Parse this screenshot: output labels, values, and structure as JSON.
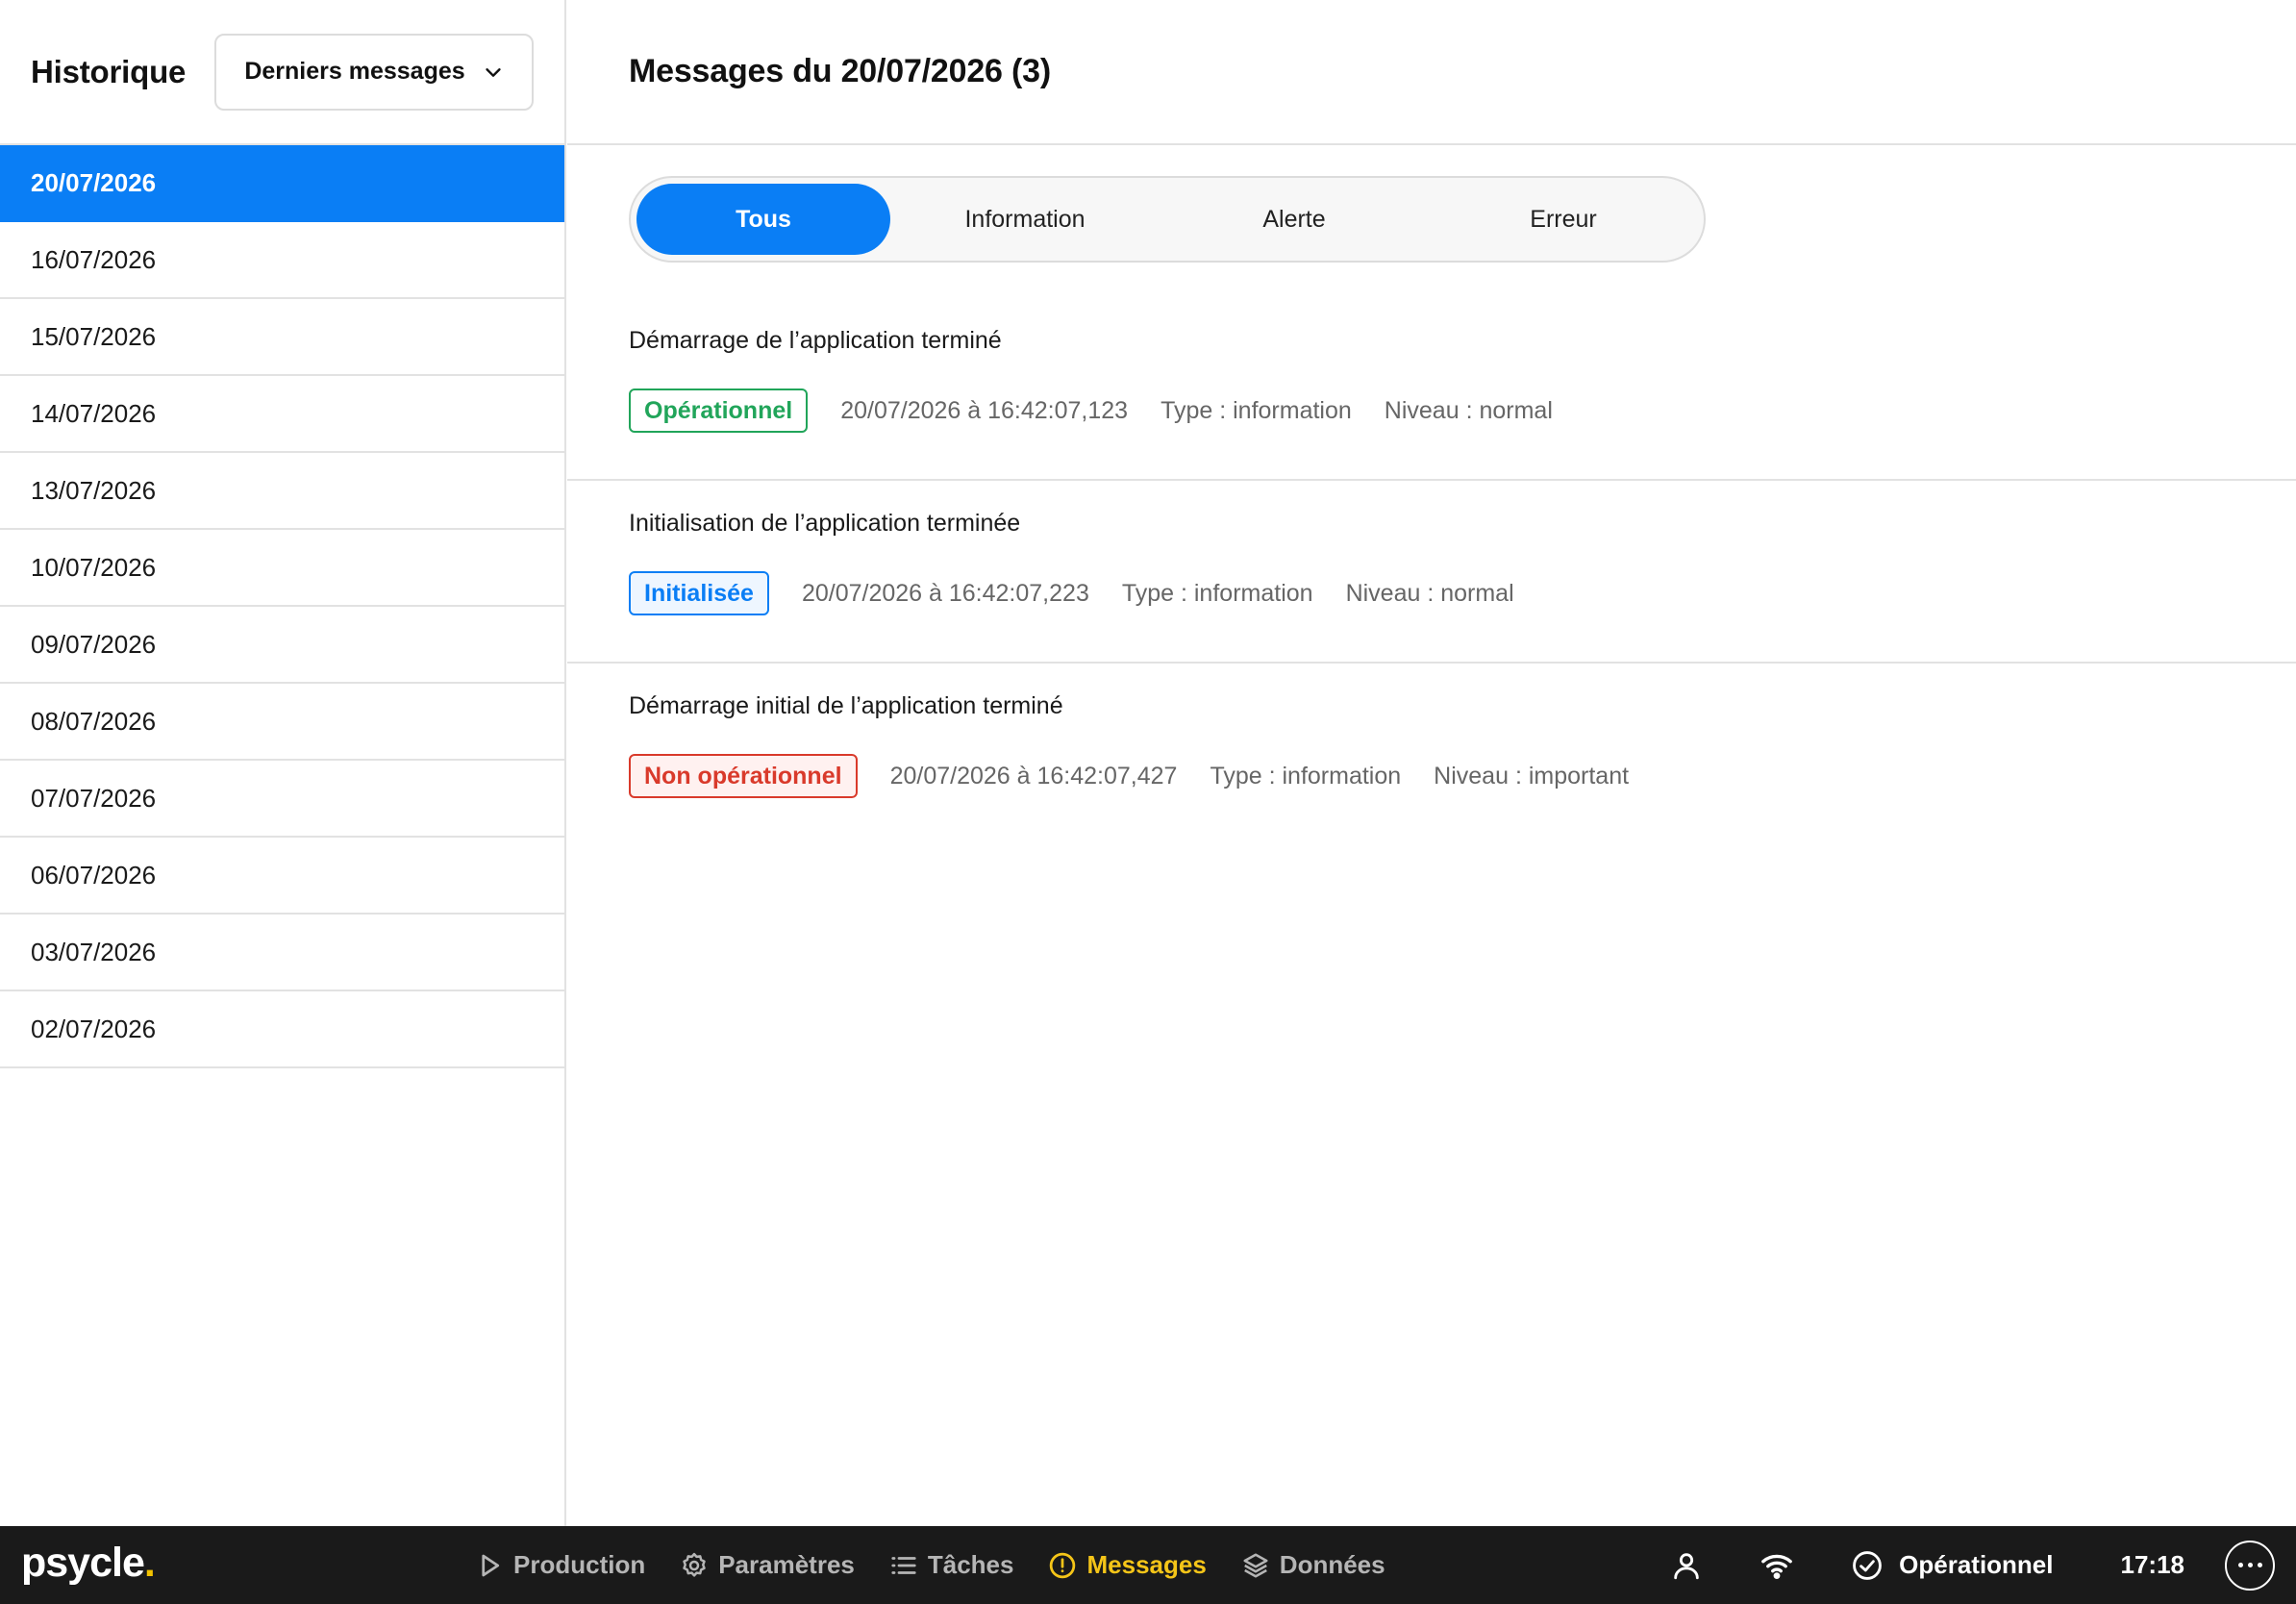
{
  "sidebar": {
    "title": "Historique",
    "dropdown": {
      "label": "Derniers messages",
      "icon": "chevron-down-icon"
    },
    "dates": [
      "20/07/2026",
      "16/07/2026",
      "15/07/2026",
      "14/07/2026",
      "13/07/2026",
      "10/07/2026",
      "09/07/2026",
      "08/07/2026",
      "07/07/2026",
      "06/07/2026",
      "03/07/2026",
      "02/07/2026"
    ],
    "selected_index": 0
  },
  "main": {
    "title": "Messages du 20/07/2026 (3)",
    "filters": [
      "Tous",
      "Information",
      "Alerte",
      "Erreur"
    ],
    "active_filter": "Tous",
    "messages": [
      {
        "title": "Démarrage de l’application terminé",
        "badge": "Opérationnel",
        "badge_color": "#21a55a",
        "timestamp": "20/07/2026 à 16:42:07,123",
        "type": "Type : information",
        "level": "Niveau : normal"
      },
      {
        "title": "Initialisation de l’application terminée",
        "badge": "Initialisée",
        "badge_color": "#0a7ef5",
        "timestamp": "20/07/2026 à 16:42:07,223",
        "type": "Type : information",
        "level": "Niveau : normal"
      },
      {
        "title": "Démarrage initial de l’application terminé",
        "badge": "Non opérationnel",
        "badge_color": "#d93a2b",
        "timestamp": "20/07/2026 à 16:42:07,427",
        "type": "Type : information",
        "level": "Niveau : important"
      }
    ]
  },
  "bottombar": {
    "logo": "psycle",
    "logo_dot": ".",
    "nav": [
      {
        "label": "Production",
        "icon": "play-icon"
      },
      {
        "label": "Paramètres",
        "icon": "gear-icon"
      },
      {
        "label": "Tâches",
        "icon": "list-icon"
      },
      {
        "label": "Messages",
        "icon": "alert-circle-icon",
        "active": true
      },
      {
        "label": "Données",
        "icon": "layers-icon"
      }
    ],
    "status": "Opérationnel",
    "time": "17:18",
    "icons": [
      "user-icon",
      "wifi-icon",
      "check-circle-icon",
      "more-icon"
    ]
  },
  "colors": {
    "accent": "#0a7ef5",
    "active_nav": "#f5c518",
    "bottom_bar": "#1a1a1a"
  }
}
